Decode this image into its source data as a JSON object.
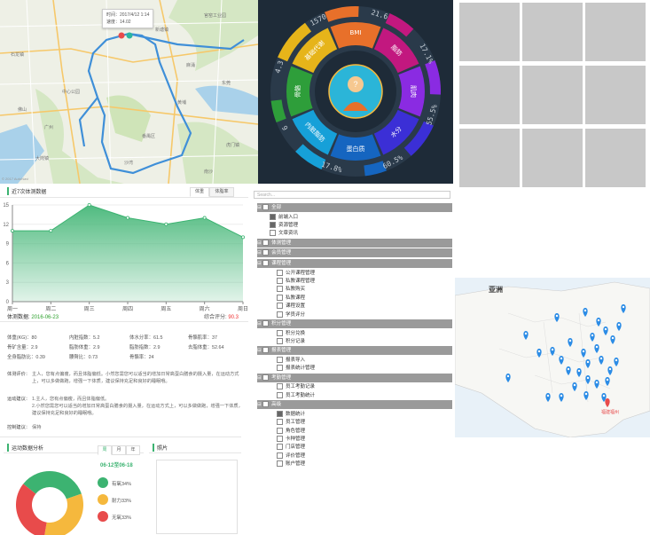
{
  "map": {
    "tooltip_time": "时间：2017/4/12 1:14",
    "tooltip_speed": "速度：14.02",
    "copyright": "© 2017 AutoNavi",
    "place_labels": [
      "官窑工业园",
      "石龙镇",
      "中心公园",
      "广州",
      "番禺区",
      "东莞",
      "佛山",
      "南沙",
      "黄埔",
      "大岗镇",
      "新塘镇",
      "麻涌",
      "虎门镇",
      "沙湾"
    ]
  },
  "donut": {
    "inner_labels": [
      "BMI",
      "脂肪",
      "肌肉",
      "水分",
      "蛋白质",
      "内脏脂肪",
      "骨骼",
      "基础代谢"
    ],
    "outer_values": [
      "21.6",
      "17.1%",
      "55.5%",
      "60.5%",
      "17.8%",
      "9",
      "4.3",
      "1570"
    ],
    "colors": [
      "#e8702a",
      "#c2187f",
      "#8a2be2",
      "#3b2fd6",
      "#1565c0",
      "#16a0d8",
      "#2e9e3a",
      "#e6b41a"
    ]
  },
  "body": {
    "section_title": "近7次体测数据",
    "tabs": [
      "体重",
      "体脂率"
    ],
    "chart_data": {
      "type": "area",
      "categories": [
        "周一",
        "周二",
        "周三",
        "周四",
        "周五",
        "周六",
        "周日"
      ],
      "values": [
        11,
        11,
        15,
        13,
        12,
        13,
        10
      ],
      "ylim": [
        0,
        15
      ],
      "yticks": [
        0,
        3,
        6,
        9,
        12,
        15
      ],
      "color": "#3cb371"
    },
    "date_label": "体测数据: ",
    "date_value": "2016-06-23",
    "score_label": "综合评分: ",
    "score_value": "90.3",
    "metrics": [
      [
        "体重(KG)：80",
        "内脏指数：5.2",
        "体水分率：61.5",
        "骨骼肌率：37"
      ],
      [
        "骨矿含量：2.9",
        "脂肪体重：2.9",
        "脂肪指数：2.9",
        "去脂体重：52.64"
      ],
      [
        "全身脂肪比：0.39",
        "腰臀比：0.73",
        "骨骼率：24",
        ""
      ]
    ],
    "eval_label": "体测评价：",
    "eval_text": "主人，您有点偏瘦，而且体脂偏低。小然您需您可以适当的增加日常高蛋白膳食的摄入量，在运动方式上，可以多做做跑，增强一下体质，建议保持充足和良好的睡眠哦。",
    "advice_label": "运动建议：",
    "advice_items": [
      "1.主人，您有点偏瘦，而且体脂偏低。",
      "2.小然您需您可以适当的增加日常高蛋白膳食的摄入量，在运动方式上，可以多做做跑，增强一下体质，建议保持充足和良好的睡眠哦。"
    ],
    "control_label": "控制建议：",
    "control_value": "保持",
    "activity_title": "运动数据分析",
    "activity_tabs": [
      "周",
      "月",
      "年"
    ],
    "activity_range": "06-12至06-18",
    "activity_legend": [
      "有氧34%",
      "耐力33%",
      "无氧33%"
    ],
    "activity_colors": [
      "#3cb371",
      "#f5b83d",
      "#e84b4b"
    ],
    "photo_title": "照片"
  },
  "tree": {
    "search_placeholder": "Search...",
    "rows": [
      {
        "type": "group",
        "text": "全部"
      },
      {
        "type": "leaf",
        "text": "前端入口",
        "indent": 1,
        "dark": true
      },
      {
        "type": "leaf",
        "text": "资源管理",
        "indent": 1,
        "dark": true
      },
      {
        "type": "leaf",
        "text": "文章资讯",
        "indent": 1,
        "dark": false
      },
      {
        "type": "group",
        "text": "体测管理"
      },
      {
        "type": "group",
        "text": "会员管理"
      },
      {
        "type": "group",
        "text": "课程管理"
      },
      {
        "type": "leaf",
        "text": "公开课程管理",
        "indent": 2,
        "dark": false
      },
      {
        "type": "leaf",
        "text": "私教课程管理",
        "indent": 2,
        "dark": false
      },
      {
        "type": "leaf",
        "text": "私教购买",
        "indent": 2,
        "dark": false
      },
      {
        "type": "leaf",
        "text": "私教课程",
        "indent": 2,
        "dark": false
      },
      {
        "type": "leaf",
        "text": "课程设置",
        "indent": 2,
        "dark": false
      },
      {
        "type": "leaf",
        "text": "学员评分",
        "indent": 2,
        "dark": false
      },
      {
        "type": "group",
        "text": "积分管理"
      },
      {
        "type": "leaf",
        "text": "积分兑换",
        "indent": 2,
        "dark": false
      },
      {
        "type": "leaf",
        "text": "积分记录",
        "indent": 2,
        "dark": false
      },
      {
        "type": "group",
        "text": "报表管理"
      },
      {
        "type": "leaf",
        "text": "报表导入",
        "indent": 2,
        "dark": false
      },
      {
        "type": "leaf",
        "text": "报表统计管理",
        "indent": 2,
        "dark": false
      },
      {
        "type": "group",
        "text": "考勤管理"
      },
      {
        "type": "leaf",
        "text": "员工考勤记录",
        "indent": 2,
        "dark": false
      },
      {
        "type": "leaf",
        "text": "员工考勤统计",
        "indent": 2,
        "dark": false
      },
      {
        "type": "group",
        "text": "高级"
      },
      {
        "type": "leaf",
        "text": "数据统计",
        "indent": 2,
        "dark": true
      },
      {
        "type": "leaf",
        "text": "员工管理",
        "indent": 2,
        "dark": false
      },
      {
        "type": "leaf",
        "text": "角色管理",
        "indent": 2,
        "dark": false
      },
      {
        "type": "leaf",
        "text": "卡种管理",
        "indent": 2,
        "dark": false
      },
      {
        "type": "leaf",
        "text": "门店管理",
        "indent": 2,
        "dark": false
      },
      {
        "type": "leaf",
        "text": "评价管理",
        "indent": 2,
        "dark": false
      },
      {
        "type": "leaf",
        "text": "账户管理",
        "indent": 2,
        "dark": false
      }
    ]
  },
  "china": {
    "title": "亚洲",
    "highlight_label": "福建福州",
    "marker_color": "#2b8ce6",
    "highlight_color": "#e84b4b"
  }
}
